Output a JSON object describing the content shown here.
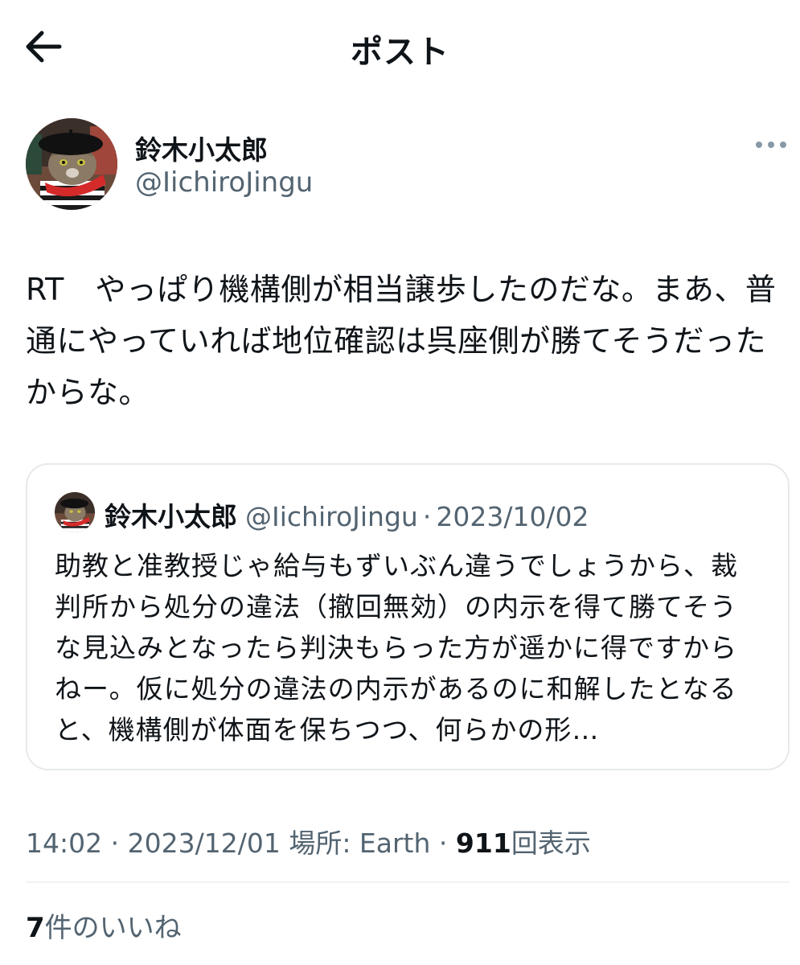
{
  "header": {
    "title": "ポスト",
    "back_icon": "arrow-left-icon"
  },
  "author": {
    "name": "鈴木小太郎",
    "handle": "@IichiroJingu",
    "avatar": "cat-avatar",
    "more_icon": "more-horizontal-icon"
  },
  "post": {
    "text": "RT　やっぱり機構側が相当譲歩したのだな。まあ、普通にやっていれば地位確認は呉座側が勝てそうだったからな。"
  },
  "quote": {
    "name": "鈴木小太郎",
    "handle": "@IichiroJingu",
    "separator": "·",
    "date": "2023/10/02",
    "text": "助教と准教授じゃ給与もずいぶん違うでしょうから、裁判所から処分の違法（撤回無効）の内示を得て勝てそうな見込みとなったら判決もらった方が遥かに得ですからねー。仮に処分の違法の内示があるのに和解したとなると、機構側が体面を保ちつつ、何らかの形…"
  },
  "meta": {
    "time": "14:02",
    "sep": "·",
    "date": "2023/12/01",
    "location_label": "場所: Earth",
    "views_count": "911",
    "views_label": "回表示"
  },
  "likes": {
    "count": "7",
    "label": "件のいいね"
  },
  "colors": {
    "text": "#0f1419",
    "secondary": "#536471",
    "border": "#e6e9ec"
  }
}
